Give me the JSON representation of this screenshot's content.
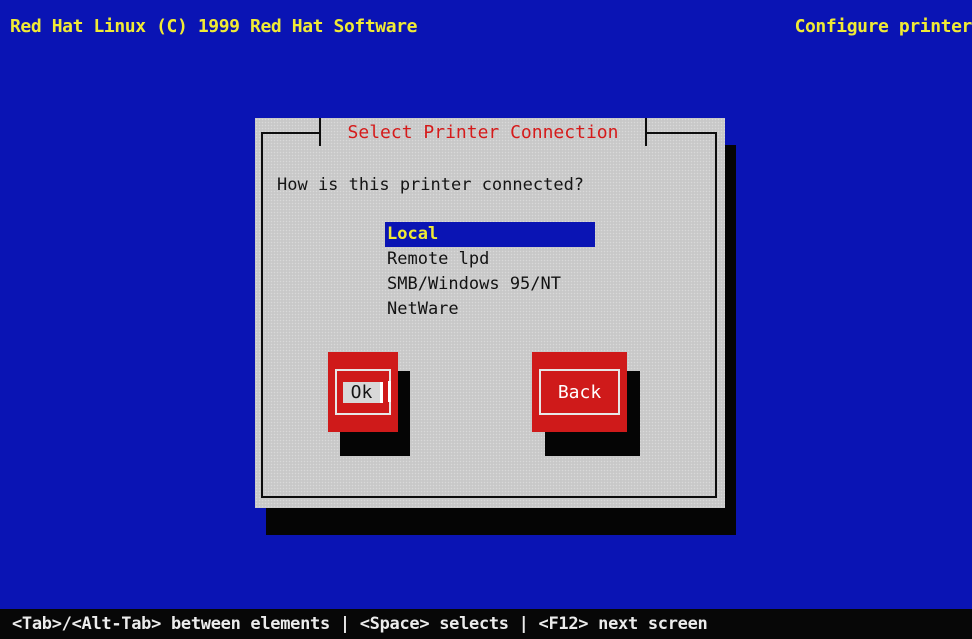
{
  "header": {
    "left_text": "Red Hat Linux (C) 1999 Red Hat Software",
    "right_text": "Configure printer"
  },
  "dialog": {
    "title": "Select Printer Connection",
    "prompt": "How is this printer connected?",
    "options": [
      {
        "label": "Local",
        "selected": true
      },
      {
        "label": "Remote lpd",
        "selected": false
      },
      {
        "label": "SMB/Windows 95/NT",
        "selected": false
      },
      {
        "label": "NetWare",
        "selected": false
      }
    ],
    "buttons": {
      "ok": "Ok",
      "back": "Back"
    }
  },
  "footer": {
    "help_text": "<Tab>/<Alt-Tab> between elements  | <Space> selects | <F12> next screen"
  },
  "colors": {
    "screen_background": "#0a14b4",
    "header_text": "#f0ea35",
    "dialog_background": "#c8c8c8",
    "title_text": "#d51a1a",
    "button_background": "#cf1a1a",
    "selected_background": "#0a14b4",
    "selected_text": "#f0ea35"
  }
}
